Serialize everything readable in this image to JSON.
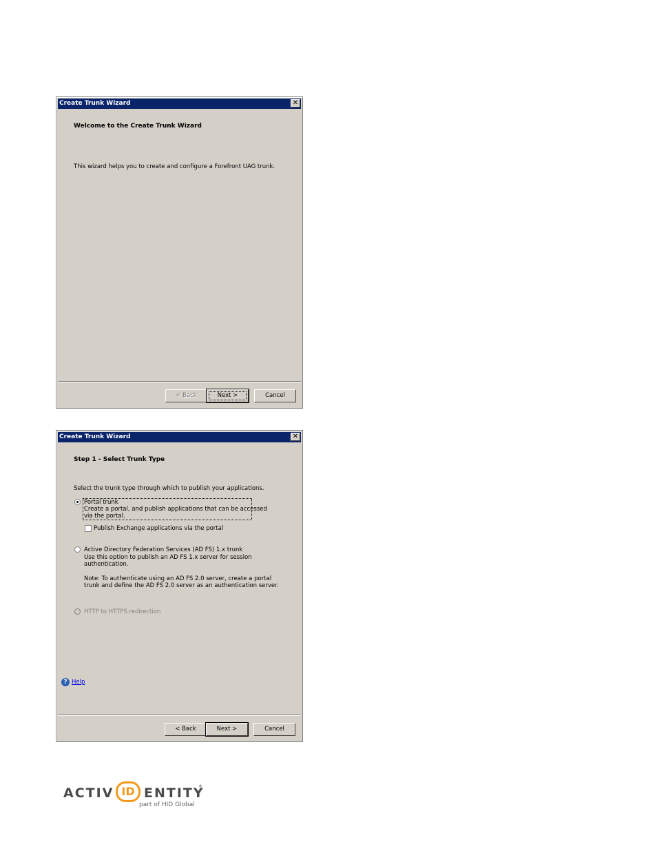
{
  "dialog1": {
    "title": "Create Trunk Wizard",
    "close_glyph": "✕",
    "heading": "Welcome to the Create Trunk Wizard",
    "intro": "This wizard helps you to create and configure a Forefront UAG trunk.",
    "buttons": {
      "back": "< Back",
      "next": "Next >",
      "cancel": "Cancel"
    }
  },
  "dialog2": {
    "title": "Create Trunk Wizard",
    "close_glyph": "✕",
    "heading": "Step 1 - Select Trunk Type",
    "instruction": "Select the trunk type through which to publish your applications.",
    "portal_trunk": {
      "label": "Portal trunk",
      "desc_line1": "Create a portal, and publish applications that can be accessed",
      "desc_line2": "via the portal."
    },
    "publish_exchange": "Publish Exchange applications via the portal",
    "adfs_trunk": {
      "label": "Active Directory Federation Services (AD FS) 1.x trunk",
      "desc_line1": "Use this option to publish an AD FS 1.x server for session",
      "desc_line2": "authentication.",
      "note_line1": "Note: To authenticate using an AD FS 2.0 server, create a portal",
      "note_line2": "trunk and define the AD FS 2.0 server as an authentication server."
    },
    "http_redirect": "HTTP to HTTPS redirection",
    "help_label": "Help",
    "help_glyph": "?",
    "buttons": {
      "back": "< Back",
      "next": "Next >",
      "cancel": "Cancel"
    }
  },
  "logo": {
    "left_text": "ACTIV",
    "id_text": "ID",
    "right_text": "ENTITY",
    "registered": "®",
    "tagline": "part of HID Global"
  },
  "colors": {
    "dialog_bg": "#d4d0c8",
    "titlebar": "#0a246a",
    "logo_accent": "#f39a1e"
  }
}
